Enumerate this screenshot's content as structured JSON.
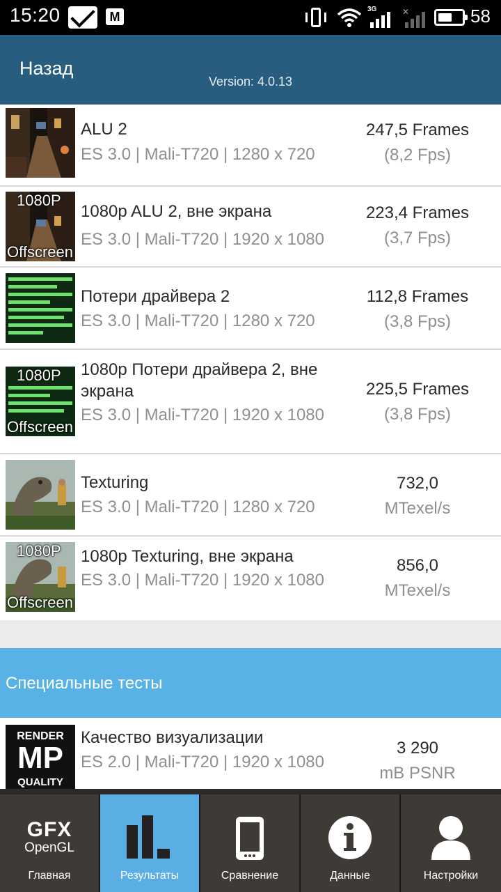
{
  "status_bar": {
    "time": "15:20",
    "network_type": "3G",
    "battery_percent": "58",
    "battery_level": 0.58
  },
  "app_bar": {
    "back_label": "Назад",
    "version": "Version: 4.0.13"
  },
  "results": [
    {
      "title": "ALU 2",
      "subtitle": "ES 3.0 | Mali-T720 | 1280 x 720",
      "score": "247,5 Frames",
      "unit": "(8,2 Fps)",
      "thumb": "alu-scene"
    },
    {
      "title": "1080p ALU 2, вне экрана",
      "subtitle": "ES 3.0 | Mali-T720 | 1920 x 1080",
      "score": "223,4 Frames",
      "unit": "(3,7 Fps)",
      "thumb": "alu-scene",
      "thumb_top": "1080P",
      "thumb_bottom": "Offscreen"
    },
    {
      "title": "Потери драйвера 2",
      "subtitle": "ES 3.0 | Mali-T720 | 1280 x 720",
      "score": "112,8 Frames",
      "unit": "(3,8 Fps)",
      "thumb": "driver-bars"
    },
    {
      "title": "1080p Потери драйвера 2, вне экрана",
      "subtitle": "ES 3.0 | Mali-T720 | 1920 x 1080",
      "score": "225,5 Frames",
      "unit": "(3,8 Fps)",
      "thumb": "driver-bars",
      "thumb_top": "1080P",
      "thumb_bottom": "Offscreen"
    },
    {
      "title": "Texturing",
      "subtitle": "ES 3.0 | Mali-T720 | 1280 x 720",
      "score": "732,0",
      "unit": "MTexel/s",
      "thumb": "dino-scene"
    },
    {
      "title": "1080p Texturing, вне экрана",
      "subtitle": "ES 3.0 | Mali-T720 | 1920 x 1080",
      "score": "856,0",
      "unit": "MTexel/s",
      "thumb": "dino-scene",
      "thumb_top": "1080P",
      "thumb_bottom": "Offscreen"
    }
  ],
  "special_section": {
    "title": "Специальные тесты",
    "item": {
      "title": "Качество визуализации",
      "subtitle": "ES 2.0 | Mali-T720 | 1920 x 1080",
      "score": "3 290",
      "unit": "mB PSNR",
      "thumb_line1": "RENDER",
      "thumb_line2": "MP",
      "thumb_line3": "QUALITY"
    }
  },
  "nav": {
    "logo_line1": "GFX",
    "logo_line2": "OpenGL",
    "items": [
      {
        "label": "Главная",
        "icon": "gfx-logo"
      },
      {
        "label": "Результаты",
        "icon": "bar-chart-icon",
        "active": true
      },
      {
        "label": "Сравнение",
        "icon": "phone-icon"
      },
      {
        "label": "Данные",
        "icon": "info-icon"
      },
      {
        "label": "Настройки",
        "icon": "person-icon"
      }
    ]
  }
}
